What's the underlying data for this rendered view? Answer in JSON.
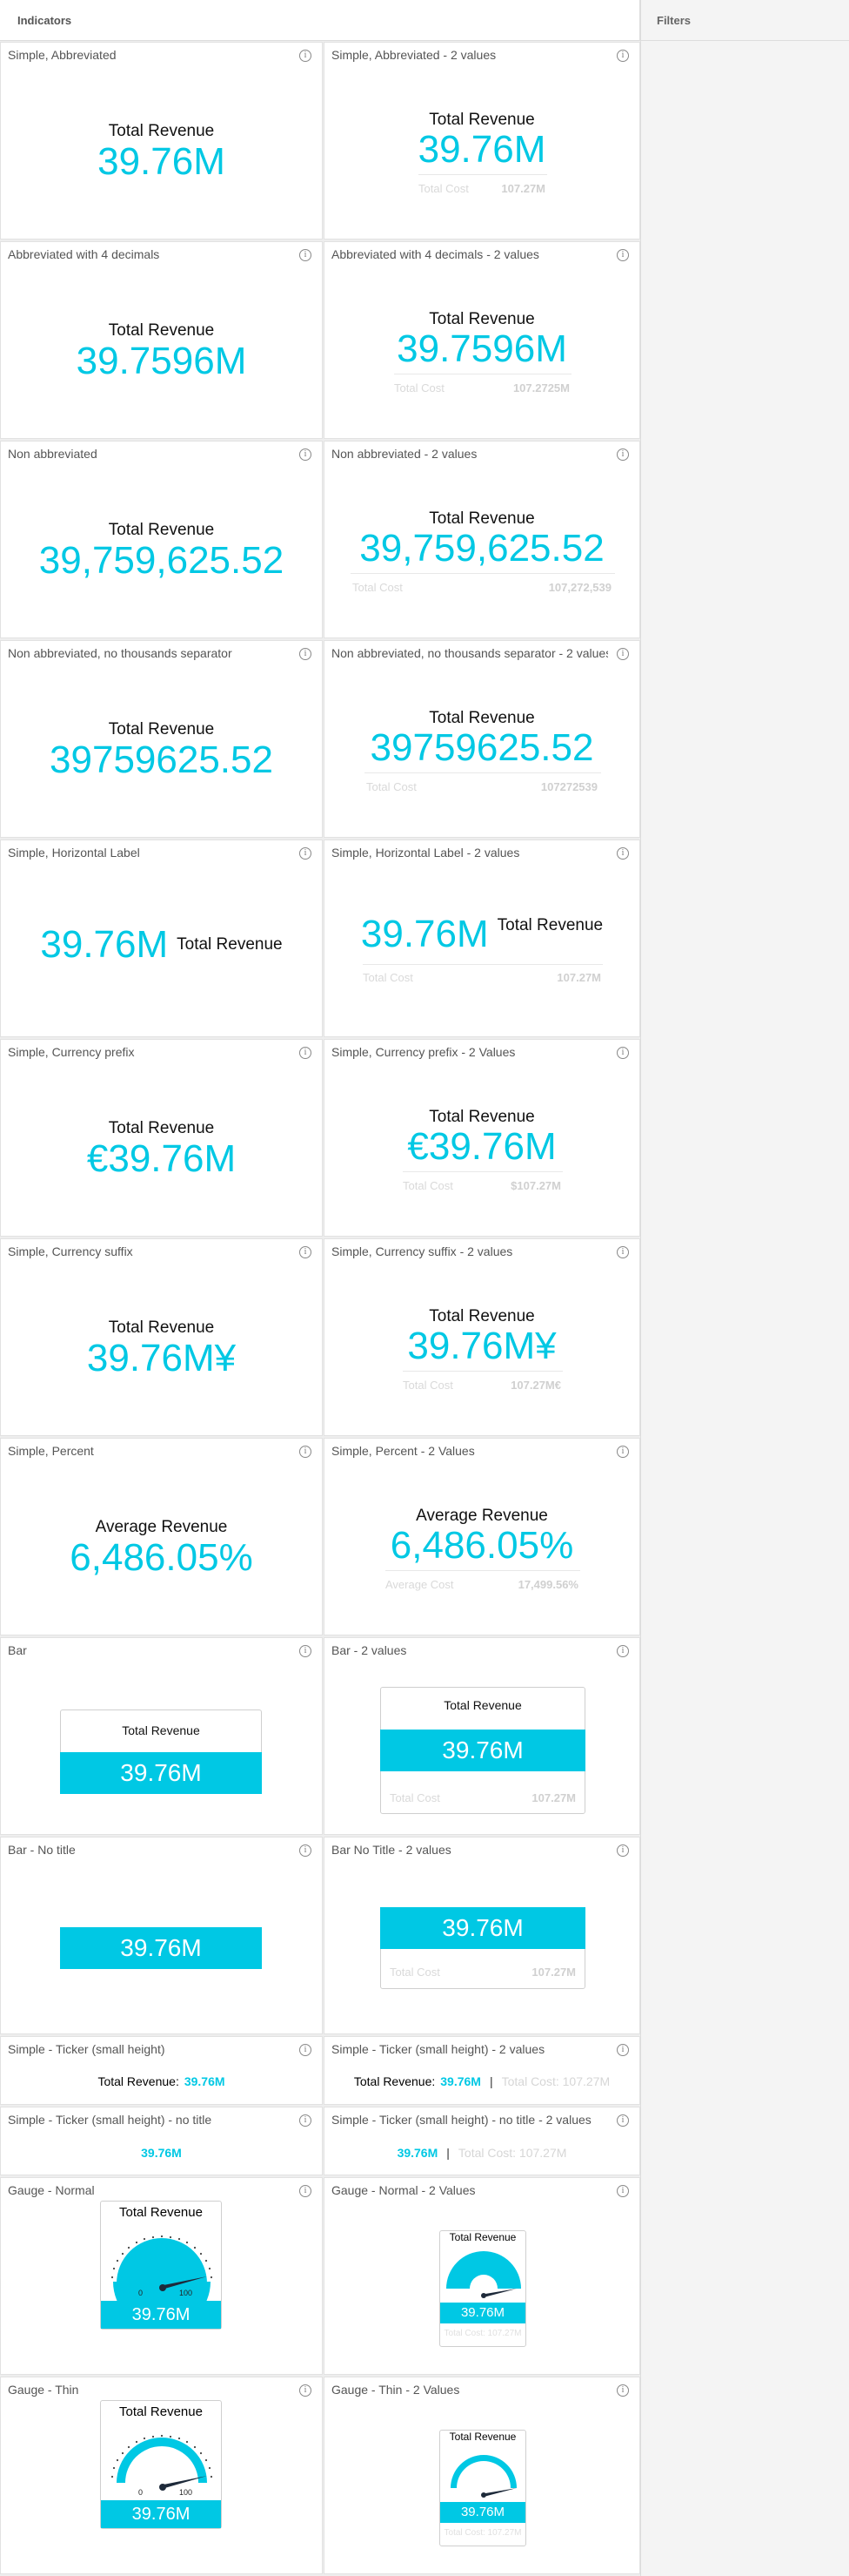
{
  "header": {
    "title": "Indicators"
  },
  "filters": {
    "title": "Filters"
  },
  "info_glyph": "i",
  "accent": "#00c8e4",
  "cards": {
    "c1": {
      "title": "Simple, Abbreviated",
      "label": "Total Revenue",
      "value": "39.76M"
    },
    "c2": {
      "title": "Simple, Abbreviated - 2 values",
      "label": "Total Revenue",
      "value": "39.76M",
      "sub_label": "Total Cost",
      "sub_value": "107.27M"
    },
    "c3": {
      "title": "Abbreviated with 4 decimals",
      "label": "Total Revenue",
      "value": "39.7596M"
    },
    "c4": {
      "title": "Abbreviated with 4 decimals - 2 values",
      "label": "Total Revenue",
      "value": "39.7596M",
      "sub_label": "Total Cost",
      "sub_value": "107.2725M"
    },
    "c5": {
      "title": "Non abbreviated",
      "label": "Total Revenue",
      "value": "39,759,625.52"
    },
    "c6": {
      "title": "Non abbreviated - 2 values",
      "label": "Total Revenue",
      "value": "39,759,625.52",
      "sub_label": "Total Cost",
      "sub_value": "107,272,539"
    },
    "c7": {
      "title": "Non abbreviated, no thousands separator",
      "label": "Total Revenue",
      "value": "39759625.52"
    },
    "c8": {
      "title": "Non abbreviated, no thousands separator - 2 values",
      "label": "Total Revenue",
      "value": "39759625.52",
      "sub_label": "Total Cost",
      "sub_value": "107272539"
    },
    "c9": {
      "title": "Simple, Horizontal Label",
      "label": "Total Revenue",
      "value": "39.76M"
    },
    "c10": {
      "title": "Simple, Horizontal Label - 2 values",
      "label": "Total Revenue",
      "value": "39.76M",
      "sub_label": "Total Cost",
      "sub_value": "107.27M"
    },
    "c11": {
      "title": "Simple, Currency prefix",
      "label": "Total Revenue",
      "value": "€39.76M"
    },
    "c12": {
      "title": "Simple, Currency prefix - 2 Values",
      "label": "Total Revenue",
      "value": "€39.76M",
      "sub_label": "Total Cost",
      "sub_value": "$107.27M"
    },
    "c13": {
      "title": "Simple, Currency suffix",
      "label": "Total Revenue",
      "value": "39.76M¥"
    },
    "c14": {
      "title": "Simple, Currency suffix - 2 values",
      "label": "Total Revenue",
      "value": "39.76M¥",
      "sub_label": "Total Cost",
      "sub_value": "107.27M€"
    },
    "c15": {
      "title": "Simple, Percent",
      "label": "Average Revenue",
      "value": "6,486.05%"
    },
    "c16": {
      "title": "Simple, Percent - 2 Values",
      "label": "Average Revenue",
      "value": "6,486.05%",
      "sub_label": "Average Cost",
      "sub_value": "17,499.56%"
    },
    "c17": {
      "title": "Bar",
      "label": "Total Revenue",
      "value": "39.76M"
    },
    "c18": {
      "title": "Bar - 2 values",
      "label": "Total Revenue",
      "value": "39.76M",
      "sub_label": "Total Cost",
      "sub_value": "107.27M"
    },
    "c19": {
      "title": "Bar - No title",
      "value": "39.76M"
    },
    "c20": {
      "title": "Bar No Title - 2 values",
      "value": "39.76M",
      "sub_label": "Total Cost",
      "sub_value": "107.27M"
    },
    "c21": {
      "title": "Simple - Ticker (small height)",
      "label": "Total Revenue:",
      "value": "39.76M"
    },
    "c22": {
      "title": "Simple - Ticker (small height) - 2 values",
      "label": "Total Revenue:",
      "value": "39.76M",
      "sep": "|",
      "sub": "Total Cost: 107.27M"
    },
    "c23": {
      "title": "Simple - Ticker (small height) - no title",
      "value": "39.76M"
    },
    "c24": {
      "title": "Simple - Ticker (small height) - no title - 2 values",
      "value": "39.76M",
      "sep": "|",
      "sub": "Total Cost: 107.27M"
    },
    "c25": {
      "title": "Gauge - Normal",
      "label": "Total Revenue",
      "value": "39.76M",
      "min": "0",
      "max": "100"
    },
    "c26": {
      "title": "Gauge - Normal - 2 Values",
      "label": "Total Revenue",
      "value": "39.76M",
      "sub": "Total Cost: 107.27M"
    },
    "c27": {
      "title": "Gauge - Thin",
      "label": "Total Revenue",
      "value": "39.76M",
      "min": "0",
      "max": "100"
    },
    "c28": {
      "title": "Gauge - Thin - 2 Values",
      "label": "Total Revenue",
      "value": "39.76M",
      "sub": "Total Cost: 107.27M"
    }
  }
}
